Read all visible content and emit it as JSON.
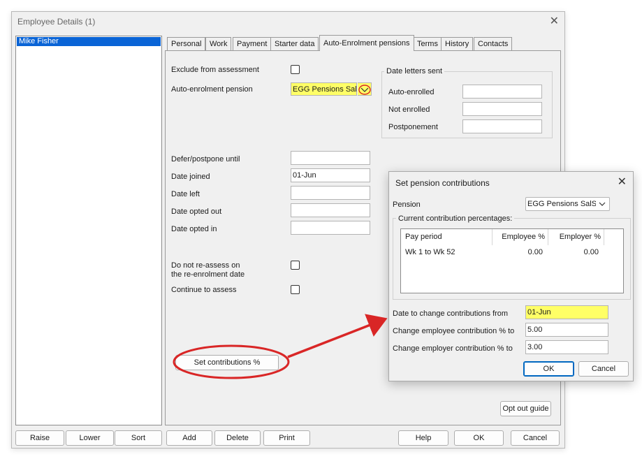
{
  "window": {
    "title": "Employee Details (1)",
    "close_glyph": "✕"
  },
  "employees": {
    "items": [
      "Mike Fisher"
    ],
    "selected": "Mike Fisher"
  },
  "tabs": [
    {
      "label": "Personal"
    },
    {
      "label": "Work"
    },
    {
      "label": "Payment"
    },
    {
      "label": "Starter data"
    },
    {
      "label": "Auto-Enrolment pensions",
      "active": true
    },
    {
      "label": "Terms"
    },
    {
      "label": "History"
    },
    {
      "label": "Contacts"
    }
  ],
  "ae": {
    "exclude_label": "Exclude from assessment",
    "exclude_checked": false,
    "pension_label": "Auto-enrolment pension",
    "pension_value": "EGG Pensions SalSa",
    "date_letters": {
      "title": "Date letters sent",
      "auto_enrolled": "Auto-enrolled",
      "not_enrolled": "Not enrolled",
      "postponement": "Postponement"
    },
    "defer_label": "Defer/postpone until",
    "joined_label": "Date joined",
    "joined_value": "01-Jun",
    "left_label": "Date left",
    "opted_out_label": "Date opted out",
    "opted_in_label": "Date opted in",
    "no_reassess_line1": "Do not re-assess on",
    "no_reassess_line2": "the re-enrolment date",
    "continue_label": "Continue to assess",
    "set_contrib_button": "Set contributions %",
    "opt_out_button": "Opt out guide"
  },
  "bottom_buttons": {
    "raise": "Raise",
    "lower": "Lower",
    "sort": "Sort",
    "add": "Add",
    "delete": "Delete",
    "print": "Print",
    "help": "Help",
    "ok": "OK",
    "cancel": "Cancel"
  },
  "dialog": {
    "title": "Set pension contributions",
    "close_glyph": "✕",
    "pension_label": "Pension",
    "pension_value": "EGG Pensions SalSac",
    "current_title": "Current contribution percentages:",
    "columns": [
      "Pay period",
      "Employee %",
      "Employer %"
    ],
    "rows": [
      {
        "period": "Wk 1 to Wk 52",
        "employee": "0.00",
        "employer": "0.00"
      }
    ],
    "date_label": "Date to change contributions from",
    "date_value": "01-Jun",
    "employee_label": "Change employee contribution % to",
    "employee_value": "5.00",
    "employer_label": "Change employer contribution % to",
    "employer_value": "3.00",
    "ok": "OK",
    "cancel": "Cancel"
  },
  "colors": {
    "highlight_yellow": "#ffff66",
    "annotation_red": "#d92626",
    "selection_blue": "#0a64d6"
  },
  "icons": {
    "dropdown": "chevron-down-icon",
    "close": "close-icon"
  }
}
